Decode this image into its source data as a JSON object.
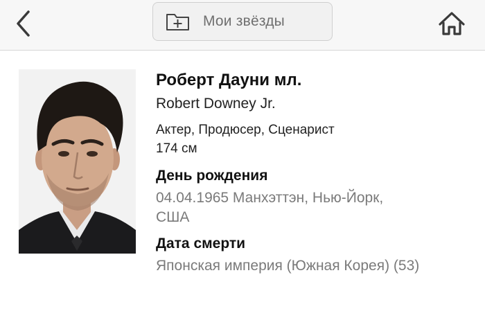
{
  "header": {
    "back_icon": "chevron-left-icon",
    "favorites_label": "Мои звёзды",
    "favorites_icon": "folder-plus-icon",
    "home_icon": "home-icon",
    "accent_color": "#3a3a3a"
  },
  "person": {
    "name_ru": "Роберт Дауни мл.",
    "name_en": "Robert Downey Jr.",
    "professions": "Актер, Продюсер, Сценарист",
    "height": "174 см",
    "birth_label": "День рождения",
    "birth_value": "04.04.1965 Манхэттэн, Нью-Йорк, США",
    "death_label": "Дата смерти",
    "death_value": "Японская империя (Южная Корея) (53)"
  }
}
